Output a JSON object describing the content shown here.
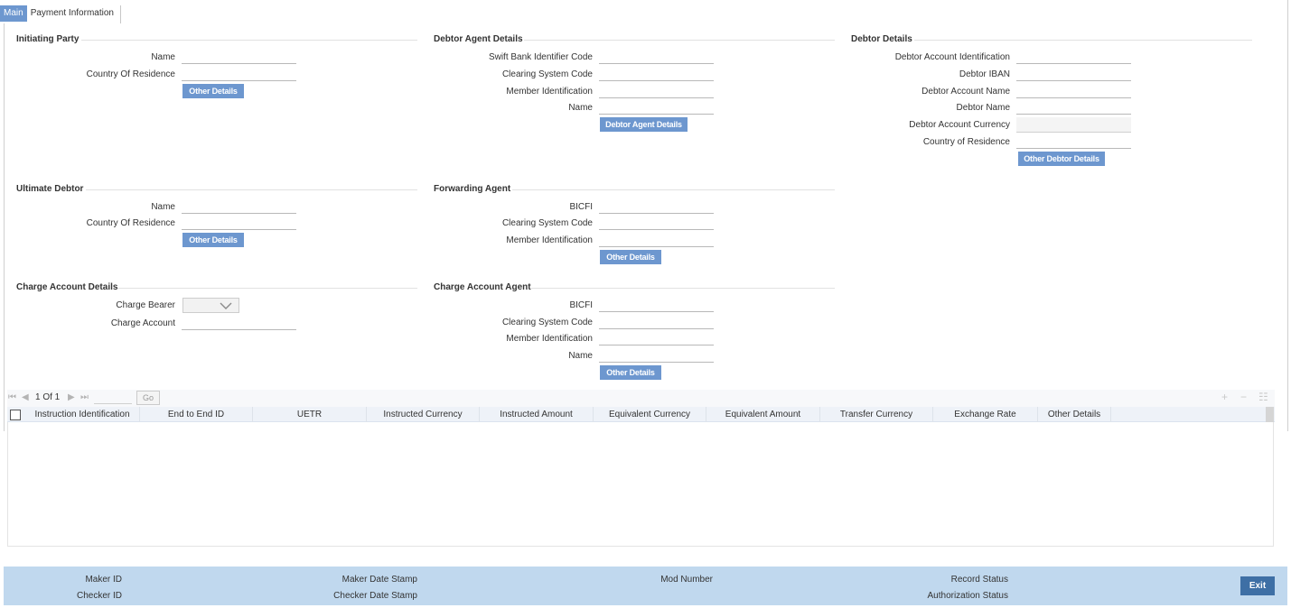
{
  "tabs": [
    "Main",
    "Payment Information"
  ],
  "initiating_party": {
    "title": "Initiating Party",
    "name_label": "Name",
    "country_label": "Country Of Residence",
    "button": "Other Details"
  },
  "debtor_agent": {
    "title": "Debtor Agent Details",
    "swift_label": "Swift Bank Identifier Code",
    "clearing_label": "Clearing System Code",
    "member_label": "Member Identification",
    "name_label": "Name",
    "button": "Debtor Agent Details"
  },
  "debtor_details": {
    "title": "Debtor Details",
    "account_id_label": "Debtor Account Identification",
    "iban_label": "Debtor IBAN",
    "account_name_label": "Debtor Account Name",
    "debtor_name_label": "Debtor Name",
    "currency_label": "Debtor Account Currency",
    "country_label": "Country of Residence",
    "button": "Other Debtor Details"
  },
  "ultimate_debtor": {
    "title": "Ultimate Debtor",
    "name_label": "Name",
    "country_label": "Country Of Residence",
    "button": "Other Details"
  },
  "forwarding_agent": {
    "title": "Forwarding Agent",
    "bicfi_label": "BICFI",
    "clearing_label": "Clearing System Code",
    "member_label": "Member Identification",
    "button": "Other Details"
  },
  "charge_account": {
    "title": "Charge Account Details",
    "bearer_label": "Charge Bearer",
    "account_label": "Charge Account"
  },
  "charge_agent": {
    "title": "Charge Account Agent",
    "bicfi_label": "BICFI",
    "clearing_label": "Clearing System Code",
    "member_label": "Member Identification",
    "name_label": "Name",
    "button": "Other Details"
  },
  "grid": {
    "pager": "1 Of 1",
    "go": "Go",
    "columns": [
      "Instruction Identification",
      "End to End ID",
      "UETR",
      "Instructed Currency",
      "Instructed Amount",
      "Equivalent Currency",
      "Equivalent Amount",
      "Transfer Currency",
      "Exchange Rate",
      "Other Details"
    ]
  },
  "footer": {
    "maker_id": "Maker ID",
    "checker_id": "Checker ID",
    "maker_date": "Maker Date Stamp",
    "checker_date": "Checker Date Stamp",
    "mod_number": "Mod Number",
    "record_status": "Record Status",
    "auth_status": "Authorization Status",
    "exit": "Exit"
  }
}
